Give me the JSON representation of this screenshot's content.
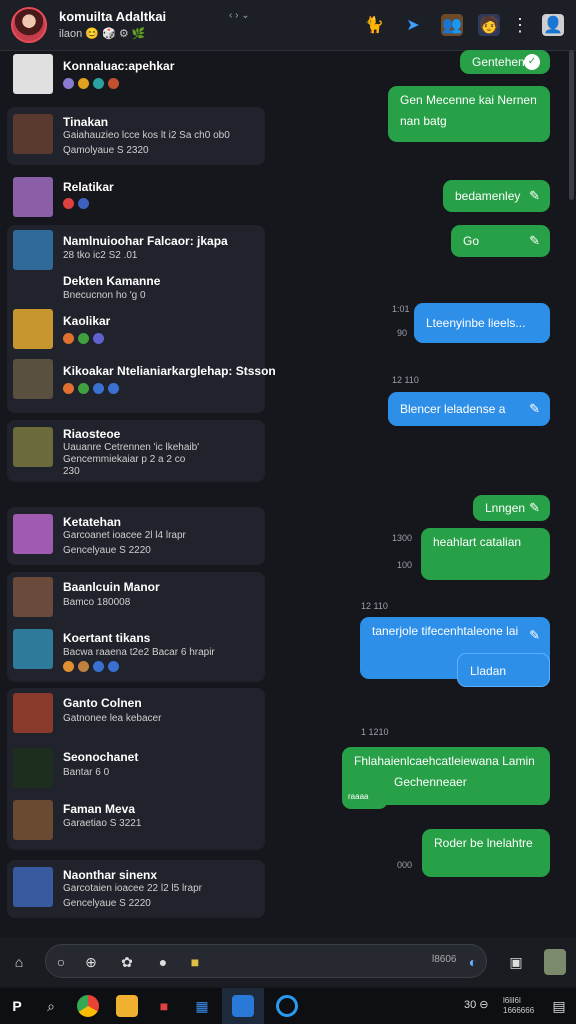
{
  "header": {
    "title": "komuilta Adaltkai",
    "subtitle": "ilaon",
    "chevrons": "‹ › ⌄",
    "icons": [
      "cat-icon",
      "share-icon",
      "group-icon",
      "avatar-icon",
      "more-icon",
      "user-icon"
    ]
  },
  "contacts": [
    {
      "name": "Konnaluac:apehkar",
      "line1": "",
      "line2": "",
      "color": "#d8d8d8"
    },
    {
      "name": "Tinakan",
      "line1": "Gaiahauzieo lcce kos lt i2 Sa ch0 ob0",
      "line2": "Qamolyaue S 2320",
      "color": "#6b4a3a"
    },
    {
      "name": "Relatikar",
      "line1": "",
      "line2": "",
      "color": "#8a5fa8"
    },
    {
      "name": "Namlnuioohar Falcaor: jkapa",
      "line1": "28 tko ic2 S2 .01",
      "line2": "",
      "color": "#2f6a9a"
    },
    {
      "name": "Dekten Kamanne",
      "line1": "Bnecucnon ho 'g 0",
      "line2": "",
      "color": "#2f6a9a"
    },
    {
      "name": "Kaolikar",
      "line1": "",
      "line2": "",
      "color": "#c7962e"
    },
    {
      "name": "Kikoakar Ntelianiarkarglehap: Stsson",
      "line1": "",
      "line2": "",
      "color": "#5a5040"
    },
    {
      "name": "Riaosteoe",
      "line1": "Uauanre Cetrennen 'ic lkehaib'",
      "line2": "Gencemmiekaiar p 2 a 2 co",
      "line3": "230",
      "color": "#6a6a3a"
    },
    {
      "name": "Ketatehan",
      "line1": "Garcoanet ioacee 2l l4 lrapr",
      "line2": "Gencelyaue S 2220",
      "color": "#a05ab0"
    },
    {
      "name": "Baanlcuin Manor",
      "line1": "Bamco 180008",
      "line2": "",
      "color": "#6a4a3a"
    },
    {
      "name": "Koertant tikans",
      "line1": "Bacwa raaena t2e2 Bacar 6 hrapir",
      "line2": "",
      "color": "#2e7a9a"
    },
    {
      "name": "Ganto Colnen",
      "line1": "Gatnonee lea kebacer",
      "line2": "",
      "color": "#8a3a2a"
    },
    {
      "name": "Seonochanet",
      "line1": "Bantar 6 0",
      "line2": "",
      "color": "#3a7a3a"
    },
    {
      "name": "Faman Meva",
      "line1": "Garaetiao S 3221",
      "line2": "",
      "color": "#6a4a30"
    },
    {
      "name": "Naonthar sinenx",
      "line1": "Garcotaien ioacee 22 l2 l5 lrapr",
      "line2": "Gencelyaue S 2220",
      "color": "#3a5aa0"
    }
  ],
  "messages": [
    {
      "text": "Gentehen",
      "kind": "green"
    },
    {
      "text": "Gen Mecenne kai Nernen nan batg",
      "kind": "green"
    },
    {
      "text": "bedamenley",
      "kind": "green"
    },
    {
      "text": "Go",
      "kind": "green"
    },
    {
      "text": "Lteenyinbe lieels...",
      "kind": "blue",
      "time": "1:01"
    },
    {
      "text": "Blencer leladense a",
      "kind": "blue",
      "time": "12 110"
    },
    {
      "text": "Lnngen",
      "kind": "green"
    },
    {
      "text": "heahlart catalian",
      "kind": "green",
      "time": "1300"
    },
    {
      "text": "tanerjole tifecenhtaleone lai",
      "kind": "blue",
      "time": "12 110"
    },
    {
      "text": "Lladan",
      "kind": "blue"
    },
    {
      "text": "Fhlahaienlcaehcatleiewana Lamin",
      "kind": "green",
      "time": "1 1210"
    },
    {
      "text": "Gechenneaer",
      "kind": "green"
    },
    {
      "text": "Roder be lnelahtre",
      "kind": "green",
      "time": "000"
    }
  ],
  "times": {
    "t_a": "1:01",
    "t_b": "90",
    "t_c": "12 110",
    "t_d": "1300",
    "t_e": "100",
    "t_f": "12 110",
    "t_g": "1 1210",
    "t_h": "000",
    "t_i": "raaaa"
  },
  "input": {
    "placeholder": "",
    "right_text": "l8606"
  },
  "taskbar": {
    "clock_top": "30 ⊖",
    "clock_r1": "l6lil6l",
    "clock_r2": "1666666"
  }
}
